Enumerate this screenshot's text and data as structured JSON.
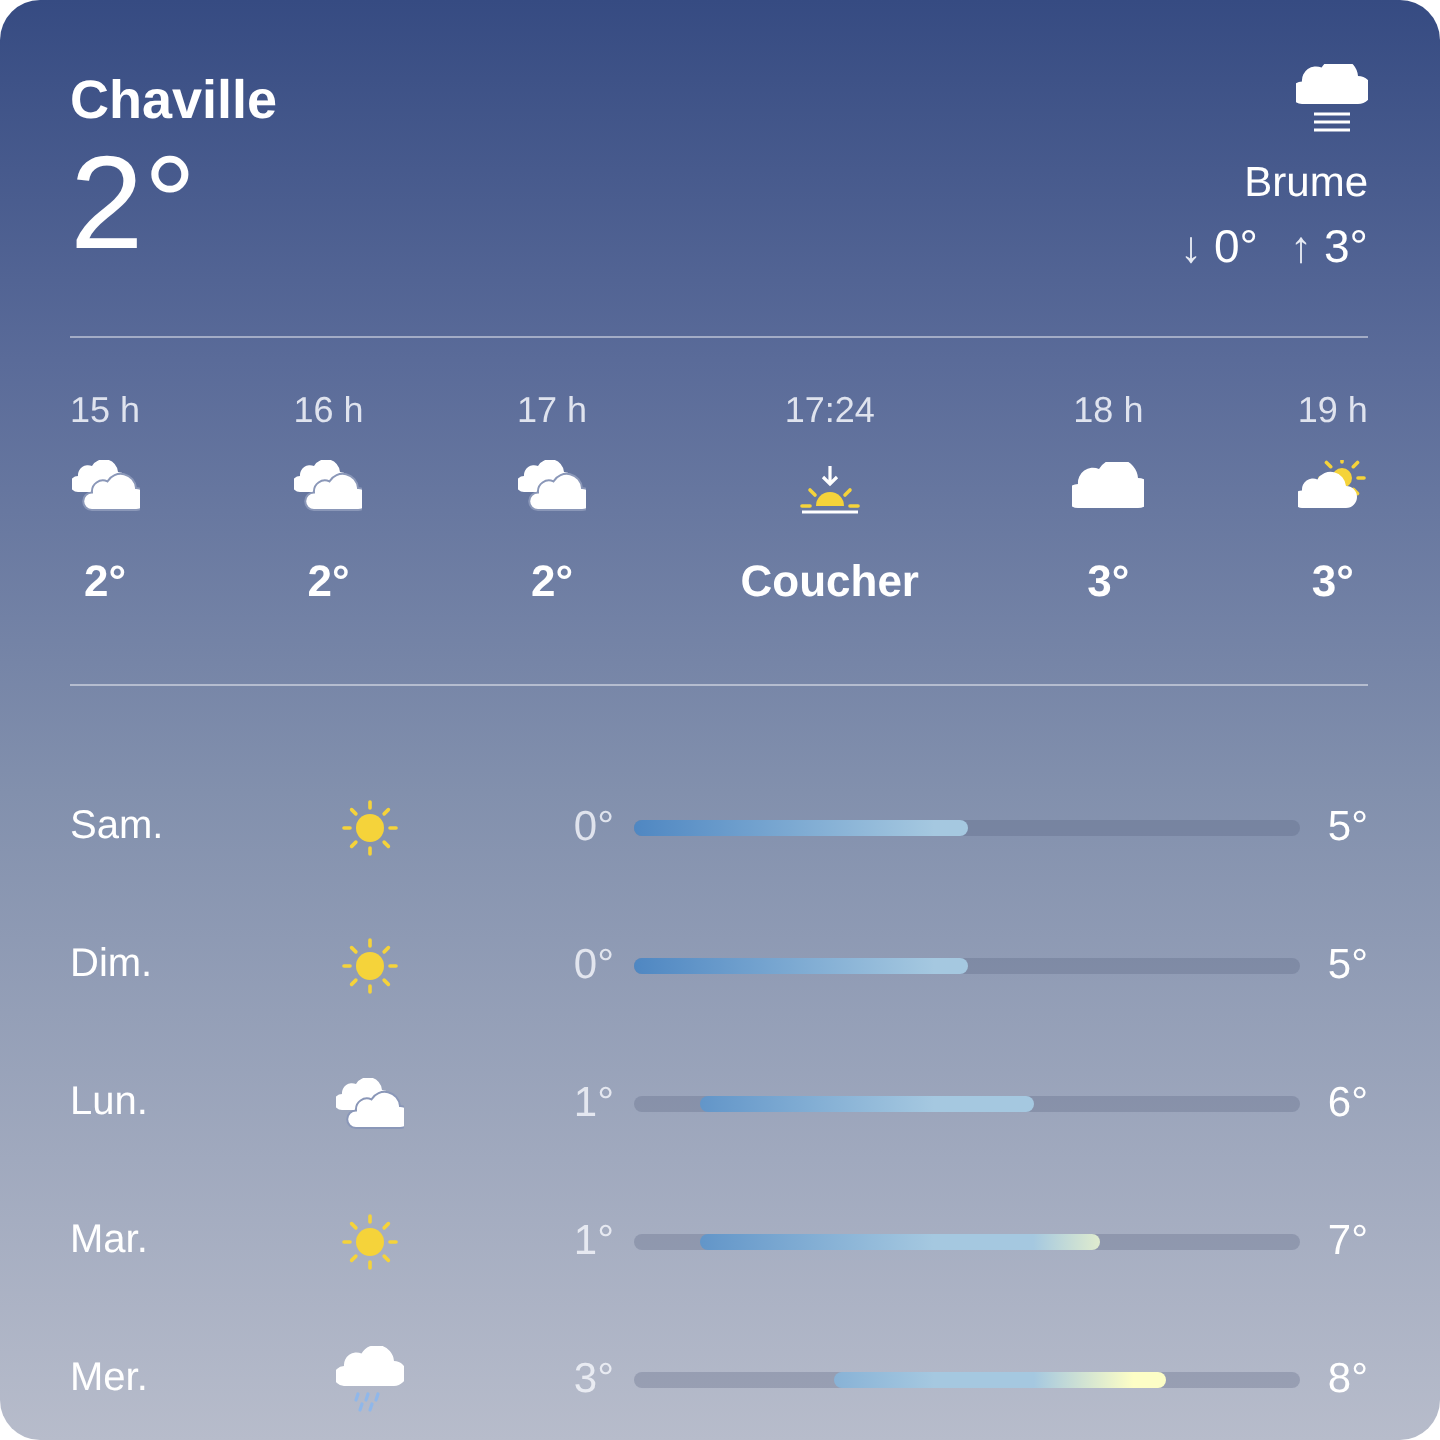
{
  "location": {
    "city": "Chaville",
    "temperature": "2°"
  },
  "current": {
    "kind": "fog",
    "condition": "Brume",
    "low_arrow": "↓",
    "low": "0°",
    "high_arrow": "↑",
    "high": "3°"
  },
  "hours": [
    {
      "time": "15 h",
      "kind": "clouds",
      "temp": "2°"
    },
    {
      "time": "16 h",
      "kind": "clouds",
      "temp": "2°"
    },
    {
      "time": "17 h",
      "kind": "clouds",
      "temp": "2°"
    },
    {
      "time": "17:24",
      "kind": "sunset",
      "temp": "Coucher"
    },
    {
      "time": "18 h",
      "kind": "cloud",
      "temp": "3°"
    },
    {
      "time": "19 h",
      "kind": "cloud-sun",
      "temp": "3°"
    }
  ],
  "days": [
    {
      "day": "Sam.",
      "kind": "sun",
      "low": "0°",
      "high": "5°"
    },
    {
      "day": "Dim.",
      "kind": "sun",
      "low": "0°",
      "high": "5°"
    },
    {
      "day": "Lun.",
      "kind": "clouds",
      "low": "1°",
      "high": "6°"
    },
    {
      "day": "Mar.",
      "kind": "sun",
      "low": "1°",
      "high": "7°"
    },
    {
      "day": "Mer.",
      "kind": "rain",
      "low": "3°",
      "high": "8°"
    }
  ]
}
